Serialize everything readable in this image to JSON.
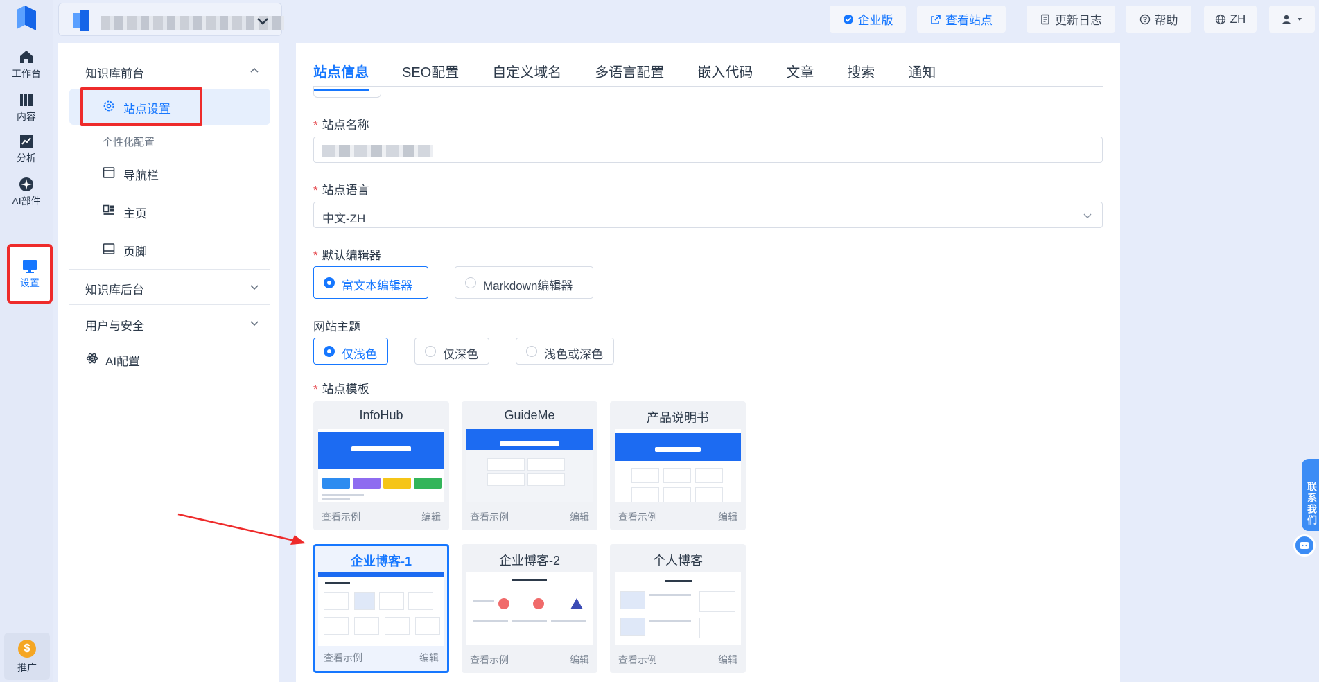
{
  "rail": {
    "items": [
      {
        "label": "工作台",
        "icon": "home-icon"
      },
      {
        "label": "内容",
        "icon": "book-icon"
      },
      {
        "label": "分析",
        "icon": "chart-icon"
      },
      {
        "label": "AI部件",
        "icon": "ai-widget-icon"
      },
      {
        "label": "设置",
        "icon": "monitor-icon"
      }
    ],
    "promo_label": "推广"
  },
  "header": {
    "enterprise_label": "企业版",
    "view_site_label": "查看站点",
    "changelog_label": "更新日志",
    "help_label": "帮助",
    "lang_label": "ZH"
  },
  "sidebar": {
    "group_front": "知识库前台",
    "site_settings": "站点设置",
    "personalize": "个性化配置",
    "navbar": "导航栏",
    "homepage": "主页",
    "footer": "页脚",
    "group_back": "知识库后台",
    "group_security": "用户与安全",
    "ai_config": "AI配置"
  },
  "tabs": [
    "站点信息",
    "SEO配置",
    "自定义域名",
    "多语言配置",
    "嵌入代码",
    "文章",
    "搜索",
    "通知"
  ],
  "form": {
    "site_name_label": "站点名称",
    "site_language_label": "站点语言",
    "site_language_value": "中文-ZH",
    "default_editor_label": "默认编辑器",
    "editor_options": [
      "富文本编辑器",
      "Markdown编辑器"
    ],
    "theme_label": "网站主题",
    "theme_options": [
      "仅浅色",
      "仅深色",
      "浅色或深色"
    ],
    "template_label": "站点模板"
  },
  "templates": [
    {
      "name": "InfoHub",
      "view": "查看示例",
      "edit": "编辑"
    },
    {
      "name": "GuideMe",
      "view": "查看示例",
      "edit": "编辑"
    },
    {
      "name": "产品说明书",
      "view": "查看示例",
      "edit": "编辑"
    },
    {
      "name": "企业博客-1",
      "view": "查看示例",
      "edit": "编辑"
    },
    {
      "name": "企业博客-2",
      "view": "查看示例",
      "edit": "编辑"
    },
    {
      "name": "个人博客",
      "view": "查看示例",
      "edit": "编辑"
    }
  ],
  "floating": {
    "contact_label": "联系我们"
  },
  "colors": {
    "accent": "#1677ff",
    "highlight": "#ee2b2b"
  }
}
